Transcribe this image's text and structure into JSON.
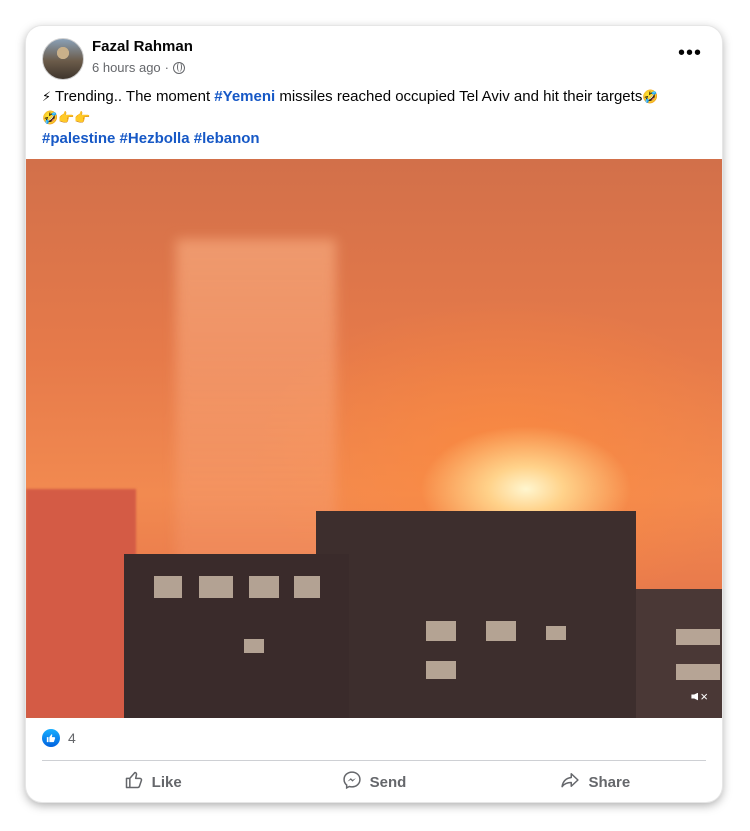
{
  "post": {
    "author": "Fazal Rahman",
    "time": "6 hours ago",
    "privacy_icon": "globe-icon",
    "more_label": "•••",
    "text_lead_emoji": "⚡",
    "text_before": "Trending.. The moment ",
    "hashtag_inline": "#Yemeni",
    "text_after": " missiles reached occupied Tel Aviv and hit their targets",
    "text_emojis": "🤣",
    "text_emojis_line2": "🤣👉👉",
    "hashtags": [
      "#palestine",
      "#Hezbolla",
      "#lebanon"
    ]
  },
  "media": {
    "mute_icon": "speaker-muted-icon"
  },
  "reactions": {
    "icon": "like-reaction-icon",
    "count": "4"
  },
  "actions": {
    "like": "Like",
    "send": "Send",
    "share": "Share"
  },
  "colors": {
    "hashtag": "#1658c6",
    "secondary_text": "#65676b",
    "like_blue": "#0062df"
  }
}
